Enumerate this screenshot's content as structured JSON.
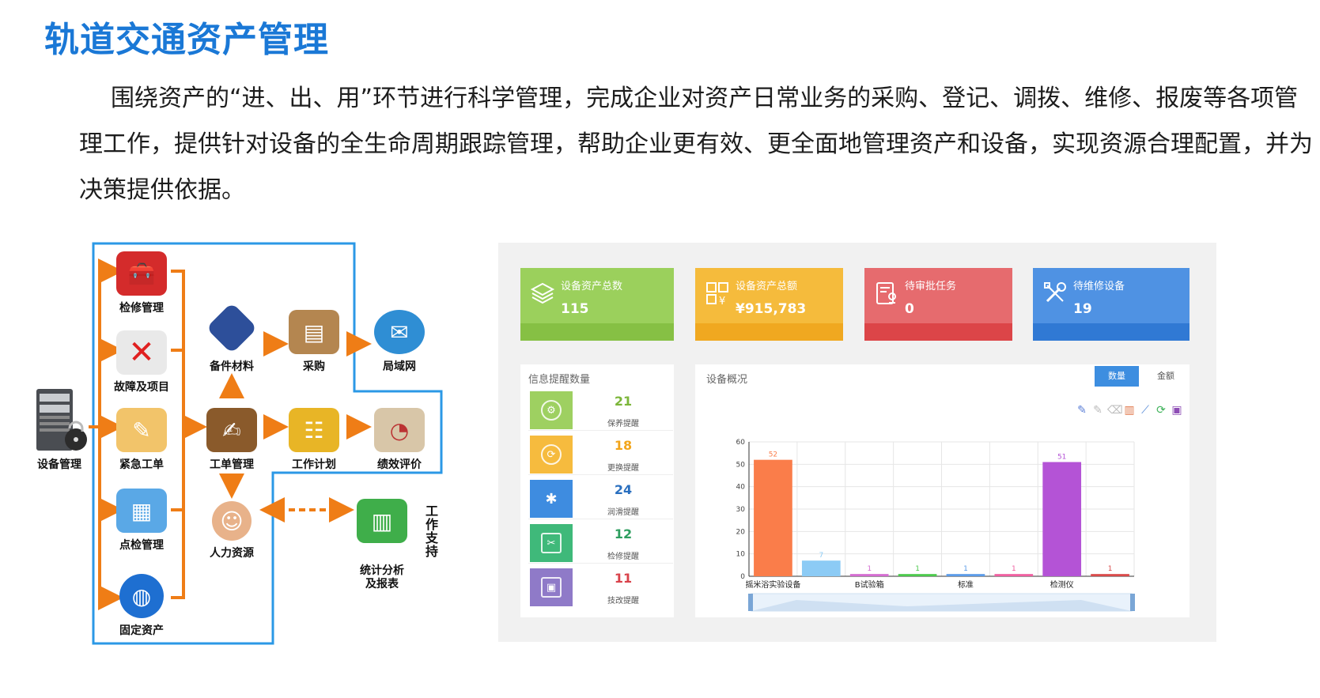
{
  "title": "轨道交通资产管理",
  "description": "围绕资产的“进、出、用”环节进行科学管理，完成企业对资产日常业务的采购、登记、调拨、维修、报废等各项管理工作，提供针对设备的全生命周期跟踪管理，帮助企业更有效、更全面地管理资产和设备，实现资源合理配置，并为决策提供依据。",
  "diagram": {
    "nodes": {
      "equipment": "设备管理",
      "maintenance": "检修管理",
      "fault": "故障及项目",
      "urgent": "紧急工单",
      "inspection": "点检管理",
      "fixed_assets": "固定资产",
      "spare_parts": "备件材料",
      "purchase": "采购",
      "lan": "局域网",
      "work_order": "工单管理",
      "work_plan": "工作计划",
      "evaluation": "绩效评价",
      "hr": "人力资源",
      "statistics": "统计分析\n及报表"
    },
    "side_label": "工作支持"
  },
  "dashboard": {
    "cards": [
      {
        "label": "设备资产总数",
        "value": "115",
        "icon": "layers-icon",
        "color": "#9bd05c",
        "dark": "#86c044"
      },
      {
        "label": "设备资产总额",
        "value": "¥915,783",
        "icon": "qr-yen-icon",
        "color": "#f5bb3c",
        "dark": "#f0a820"
      },
      {
        "label": "待审批任务",
        "value": "0",
        "icon": "approval-icon",
        "color": "#e66b6e",
        "dark": "#dc4548"
      },
      {
        "label": "待维修设备",
        "value": "19",
        "icon": "tools-icon",
        "color": "#4f92e3",
        "dark": "#3079d4"
      }
    ],
    "reminders": {
      "title": "信息提醒数量",
      "items": [
        {
          "count": "21",
          "label": "保养提醒",
          "color": "#9ed061",
          "num_color": "#7cb63a",
          "icon": "maintain-icon"
        },
        {
          "count": "18",
          "label": "更换提醒",
          "color": "#f6bb3e",
          "num_color": "#f2a51b",
          "icon": "replace-icon"
        },
        {
          "count": "24",
          "label": "润滑提醒",
          "color": "#3e8ce0",
          "num_color": "#2a6fbf",
          "icon": "lubricate-icon"
        },
        {
          "count": "12",
          "label": "检修提醒",
          "color": "#3fb97a",
          "num_color": "#2e9e5f",
          "icon": "repair-icon"
        },
        {
          "count": "11",
          "label": "技改提醒",
          "color": "#8f7ac8",
          "num_color": "#d9424a",
          "icon": "upgrade-icon"
        }
      ]
    },
    "overview": {
      "title": "设备概况",
      "tabs": [
        "数量",
        "金额"
      ],
      "active_tab": "数量"
    }
  },
  "chart_data": {
    "type": "bar",
    "categories": [
      "摇米浴实验设备",
      "",
      "B试验箱",
      "",
      "标准",
      "",
      "检测仪",
      ""
    ],
    "values": [
      52,
      7,
      1,
      1,
      1,
      1,
      51,
      1
    ],
    "colors": [
      "#fa7d4a",
      "#8ccbf5",
      "#d46bd1",
      "#4cc94c",
      "#5b9be8",
      "#ef5fa0",
      "#b453d6",
      "#d94a4a"
    ],
    "ylim": [
      0,
      60
    ],
    "yticks": [
      0,
      10,
      20,
      30,
      40,
      50,
      60
    ],
    "grid": true
  }
}
